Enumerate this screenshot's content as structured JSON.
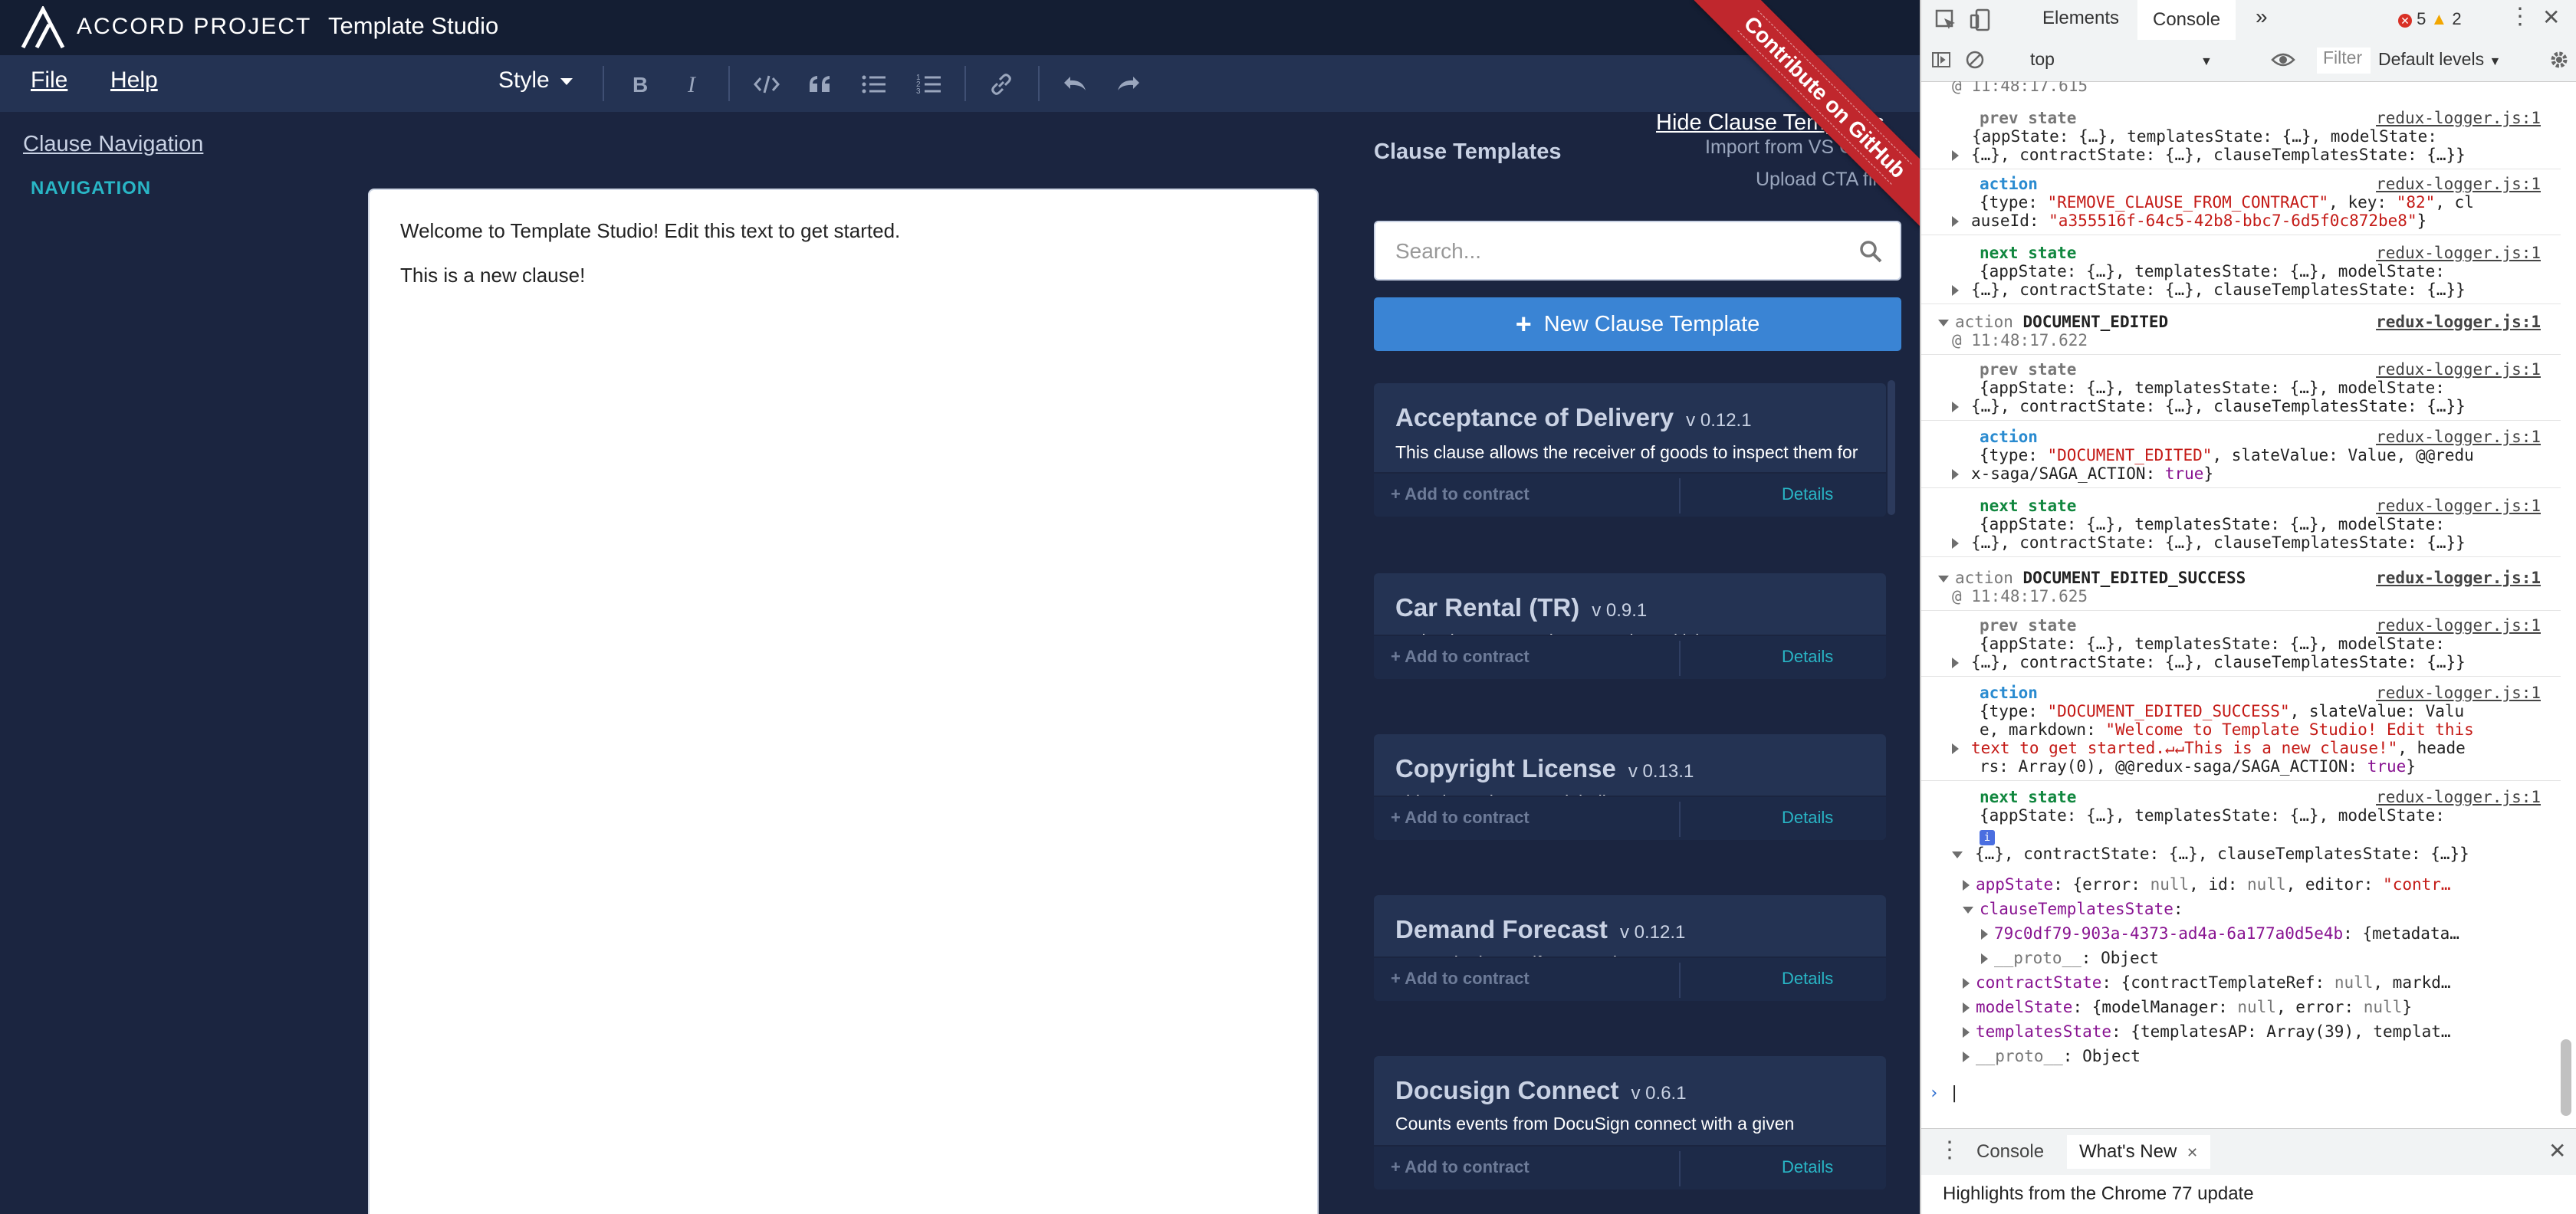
{
  "app": {
    "brand": "ACCORD PROJECT",
    "title": "Template Studio",
    "menu": {
      "file": "File",
      "help": "Help",
      "style": "Style"
    },
    "toolbar_icons": [
      "bold-icon",
      "italic-icon",
      "code-icon",
      "quote-icon",
      "bulleted-list-icon",
      "numbered-list-icon",
      "link-icon",
      "undo-icon",
      "redo-icon"
    ],
    "clause_navigation": "Clause Navigation",
    "navigation_heading": "NAVIGATION",
    "editor": {
      "paragraphs": [
        "Welcome to Template Studio! Edit this text to get started.",
        "This is a new clause!"
      ]
    },
    "clause_templates_title": "Clause Templates",
    "hide_clause_templates": "Hide Clause Templates",
    "import_vs_code": "Import from VS Code",
    "upload_cta": "Upload CTA file",
    "github_ribbon": "Contribute on GitHub",
    "search": {
      "placeholder": "Search...",
      "value": ""
    },
    "new_clause_template": "New Clause Template",
    "templates": [
      {
        "name": "Acceptance of Delivery",
        "version": "v 0.12.1",
        "description": "This clause allows the receiver of goods to inspect them for a given time period after delivery.",
        "add": "Add to contract",
        "details": "Details"
      },
      {
        "name": "Car Rental (TR)",
        "version": "v 0.9.1",
        "description": "a Simple Car Rental Contract in Turkish Language",
        "add": "Add to contract",
        "details": "Details"
      },
      {
        "name": "Copyright License",
        "version": "v 0.13.1",
        "description": "This clause is a copyright license agreement.",
        "add": "Add to contract",
        "details": "Details"
      },
      {
        "name": "Demand Forecast",
        "version": "v 0.12.1",
        "description": "A sample demandforecast clause.",
        "add": "Add to contract",
        "details": "Details"
      },
      {
        "name": "Docusign Connect",
        "version": "v 0.6.1",
        "description": "Counts events from DocuSign connect with a given envelope status.",
        "add": "Add to contract",
        "details": "Details"
      }
    ],
    "colors": {
      "background": "#1b2540",
      "accent": "#29b6c6",
      "button": "#3a84d4",
      "ribbon": "#c0272d"
    }
  },
  "devtools": {
    "tabs": {
      "elements": "Elements",
      "console": "Console"
    },
    "errors": "5",
    "warnings": "2",
    "context": "top",
    "filter": "Filter",
    "levels": "Default levels",
    "log": {
      "top_ts": "@ 11:48:17.615",
      "g1": {
        "prev_label": "prev state",
        "prev_link": "redux-logger.js:1",
        "prev_line1": "{appState: {…}, templatesState: {…}, modelState:",
        "prev_line2": "{…}, contractState: {…}, clauseTemplatesState: {…}}",
        "action_label": "action",
        "action_link": "redux-logger.js:1",
        "action_line1a": "{type: ",
        "action_line1b": "\"REMOVE_CLAUSE_FROM_CONTRACT\"",
        "action_line1c": ", key: ",
        "action_line1d": "\"82\"",
        "action_line1e": ", cl",
        "action_line2a": "auseId: ",
        "action_line2b": "\"a355516f-64c5-42b8-bbc7-6d5f0c872be8\"",
        "action_line2c": "}",
        "next_label": "next state",
        "next_link": "redux-logger.js:1",
        "next_line1": "{appState: {…}, templatesState: {…}, modelState:",
        "next_line2": "{…}, contractState: {…}, clauseTemplatesState: {…}}"
      },
      "g2": {
        "head_a": "action",
        "head_b": "DOCUMENT_EDITED",
        "head_link": "redux-logger.js:1",
        "ts": "@ 11:48:17.622",
        "prev_label": "prev state",
        "prev_link": "redux-logger.js:1",
        "prev_line1": "{appState: {…}, templatesState: {…}, modelState:",
        "prev_line2": "{…}, contractState: {…}, clauseTemplatesState: {…}}",
        "action_label": "action",
        "action_link": "redux-logger.js:1",
        "action_line1a": "{type: ",
        "action_line1b": "\"DOCUMENT_EDITED\"",
        "action_line1c": ", slateValue: Value, @@redu",
        "action_line2a": "x-saga/SAGA_ACTION: ",
        "action_line2b": "true",
        "action_line2c": "}",
        "next_label": "next state",
        "next_link": "redux-logger.js:1",
        "next_line1": "{appState: {…}, templatesState: {…}, modelState:",
        "next_line2": "{…}, contractState: {…}, clauseTemplatesState: {…}}"
      },
      "g3": {
        "head_a": "action",
        "head_b": "DOCUMENT_EDITED_SUCCESS",
        "head_link": "redux-logger.js:1",
        "ts": "@ 11:48:17.625",
        "prev_label": "prev state",
        "prev_link": "redux-logger.js:1",
        "prev_line1": "{appState: {…}, templatesState: {…}, modelState:",
        "prev_line2": "{…}, contractState: {…}, clauseTemplatesState: {…}}",
        "action_label": "action",
        "action_link": "redux-logger.js:1",
        "action_line1a": "{type: ",
        "action_line1b": "\"DOCUMENT_EDITED_SUCCESS\"",
        "action_line1c": ", slateValue: Valu",
        "action_line2a": "e, markdown: ",
        "action_line2b": "\"Welcome to Template Studio! Edit this",
        "action_line3b": "text to get started.↵↵This is a new clause!\"",
        "action_line3c": ", heade",
        "action_line4a": "rs: Array(0), @@redux-saga/SAGA_ACTION: ",
        "action_line4b": "true",
        "action_line4c": "}",
        "next_label": "next state",
        "next_link": "redux-logger.js:1",
        "next_line1": "{appState: {…}, templatesState: {…}, modelState:",
        "next_line2": "{…}, contractState: {…}, clauseTemplatesState: {…}}"
      },
      "tree": {
        "appState_k": "appState",
        "appState_v1": ": {error: ",
        "appState_v2": "null",
        "appState_v3": ", id: ",
        "appState_v4": "null",
        "appState_v5": ", editor: ",
        "appState_v6": "\"contr…",
        "cts_k": "clauseTemplatesState",
        "cts_v": ":",
        "uuid_k": "79c0df79-903a-4373-ad4a-6a177a0d5e4b",
        "uuid_v": ": {metadata…",
        "proto1_k": "__proto__",
        "proto1_v": ": Object",
        "contract_k": "contractState",
        "contract_v1": ": {contractTemplateRef: ",
        "contract_v2": "null",
        "contract_v3": ", markd…",
        "model_k": "modelState",
        "model_v1": ": {modelManager: ",
        "model_v2": "null",
        "model_v3": ", error: ",
        "model_v4": "null",
        "model_v5": "}",
        "templates_k": "templatesState",
        "templates_v": ": {templatesAP: Array(39), templat…",
        "proto2_k": "__proto__",
        "proto2_v": ": Object"
      }
    },
    "drawer": {
      "console": "Console",
      "whats_new": "What's New",
      "highlights": "Highlights from the Chrome 77 update"
    }
  }
}
